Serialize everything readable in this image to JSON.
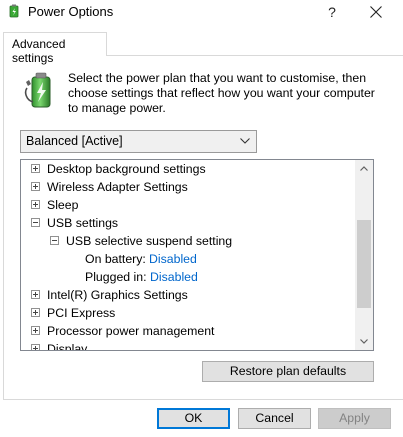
{
  "window": {
    "title": "Power Options",
    "help_label": "?",
    "icon": "power-options-icon"
  },
  "tabs": [
    {
      "label": "Advanced settings",
      "selected": true
    }
  ],
  "description": "Select the power plan that you want to customise, then choose settings that reflect how you want your computer to manage power.",
  "plan_select": {
    "value": "Balanced [Active]"
  },
  "tree": {
    "items": [
      {
        "label": "Desktop background settings",
        "expanded": false,
        "level": 0
      },
      {
        "label": "Wireless Adapter Settings",
        "expanded": false,
        "level": 0
      },
      {
        "label": "Sleep",
        "expanded": false,
        "level": 0
      },
      {
        "label": "USB settings",
        "expanded": true,
        "level": 0
      },
      {
        "label": "USB selective suspend setting",
        "expanded": true,
        "level": 1
      },
      {
        "label": "On battery:",
        "value": "Disabled",
        "level": 2
      },
      {
        "label": "Plugged in:",
        "value": "Disabled",
        "level": 2
      },
      {
        "label": "Intel(R) Graphics Settings",
        "expanded": false,
        "level": 0
      },
      {
        "label": "PCI Express",
        "expanded": false,
        "level": 0
      },
      {
        "label": "Processor power management",
        "expanded": false,
        "level": 0
      },
      {
        "label": "Display",
        "expanded": false,
        "level": 0
      }
    ]
  },
  "buttons": {
    "restore": "Restore plan defaults",
    "ok": "OK",
    "cancel": "Cancel",
    "apply": "Apply"
  },
  "colors": {
    "accent": "#0078d7",
    "link": "#0066cc",
    "battery_green": "#3aa935"
  }
}
